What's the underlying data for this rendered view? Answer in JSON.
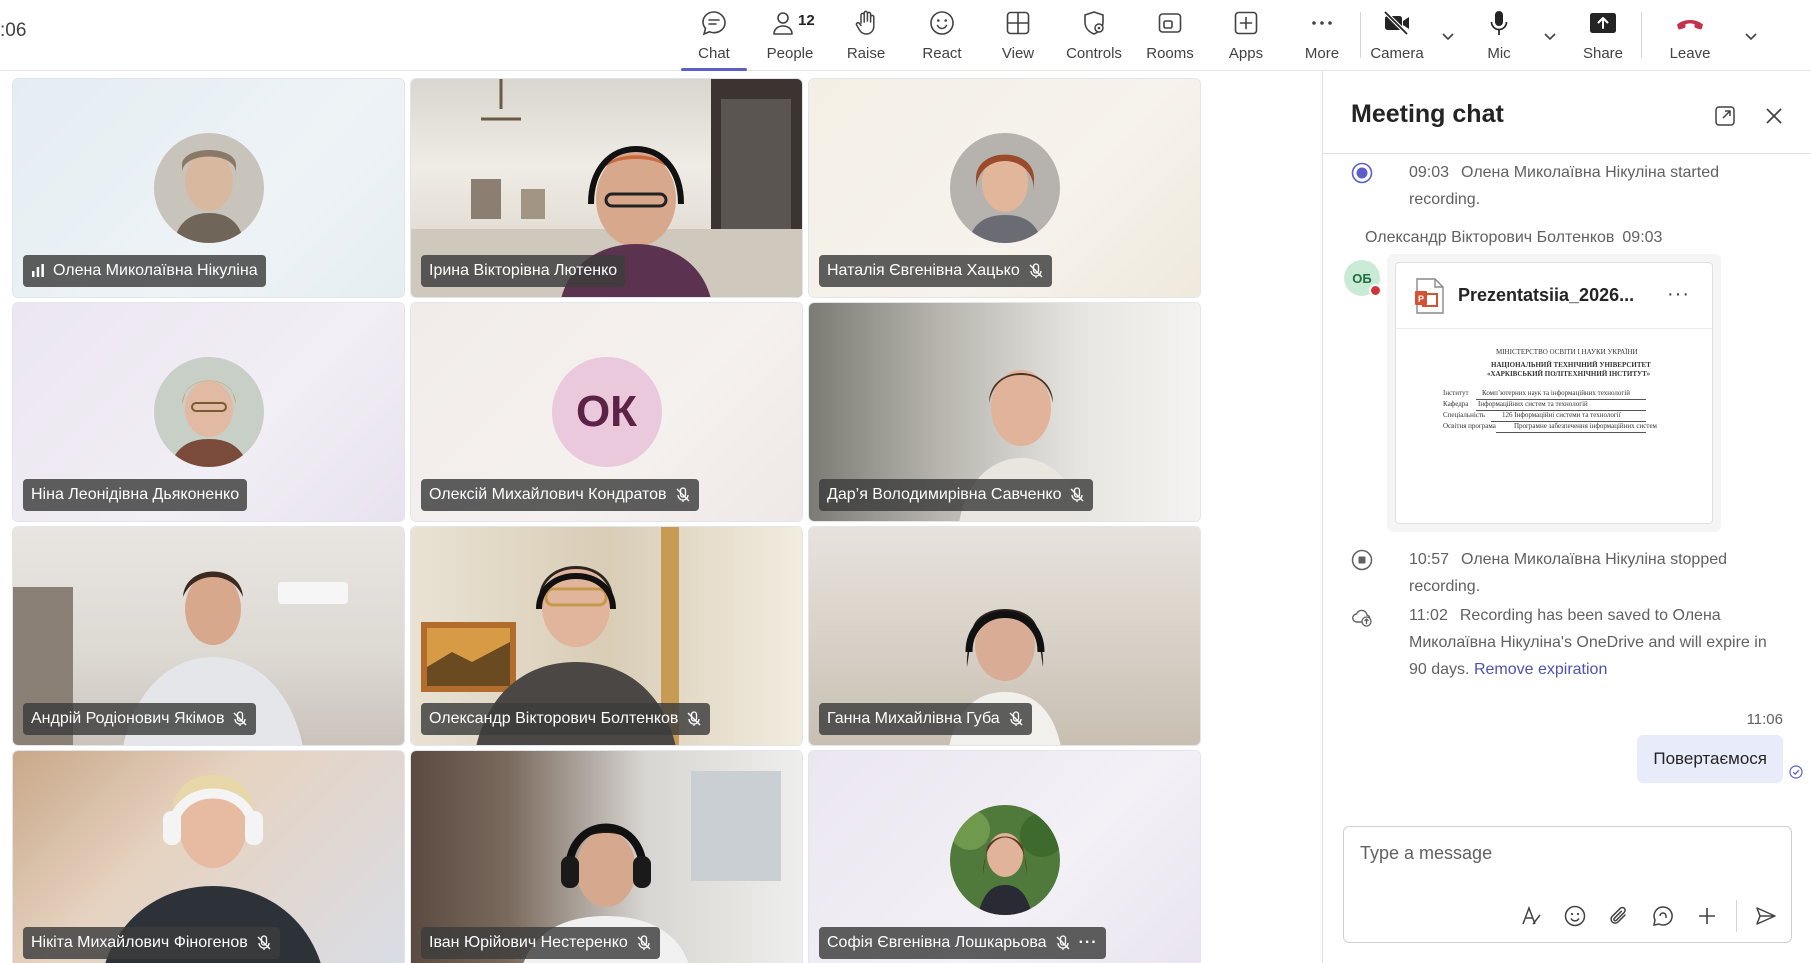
{
  "meeting": {
    "timer": ":06"
  },
  "toolbar": {
    "chat": "Chat",
    "people": "People",
    "people_count": "12",
    "raise": "Raise",
    "react": "React",
    "view": "View",
    "controls": "Controls",
    "rooms": "Rooms",
    "apps": "Apps",
    "more": "More",
    "camera": "Camera",
    "mic": "Mic",
    "share": "Share",
    "leave": "Leave"
  },
  "participants": [
    {
      "name": "Олена Миколаївна Нікуліна",
      "status": "speaking",
      "view": "avatar"
    },
    {
      "name": "Ірина Вікторівна Лютенко",
      "status": "none",
      "view": "video"
    },
    {
      "name": "Наталія Євгенівна Хацько",
      "status": "muted",
      "view": "avatar"
    },
    {
      "name": "Ніна Леонідівна Дьяконенко",
      "status": "none",
      "view": "avatar"
    },
    {
      "name": "Олексій Михайлович Кондратов",
      "status": "muted",
      "view": "initials",
      "initials": "ОК"
    },
    {
      "name": "Дар’я Володимирівна Савченко",
      "status": "muted",
      "view": "video"
    },
    {
      "name": "Андрій Родіонович Якімов",
      "status": "muted",
      "view": "video"
    },
    {
      "name": "Олександр Вікторович Болтенков",
      "status": "muted",
      "view": "video"
    },
    {
      "name": "Ганна Михайлівна Губа",
      "status": "muted",
      "view": "video"
    },
    {
      "name": "Нікіта Михайлович Фіногенов",
      "status": "muted",
      "view": "video"
    },
    {
      "name": "Іван Юрійович Нестеренко",
      "status": "muted",
      "view": "video"
    },
    {
      "name": "Софія Євгенівна Лошкарьова",
      "status": "muted",
      "view": "avatar",
      "more": "···"
    }
  ],
  "chat": {
    "title": "Meeting chat",
    "messages": {
      "rec_start_time": "09:03",
      "rec_start_text": "Олена Миколаївна Нікуліна started recording.",
      "sender": "Олександр Вікторович Болтенков",
      "sender_time": "09:03",
      "sender_initials": "ОБ",
      "file_name": "Prezentatsiia_2026...",
      "file_more": "···",
      "rec_stop_time": "10:57",
      "rec_stop_text": "Олена Миколаївна Нікуліна stopped recording.",
      "saved_time": "11:02",
      "saved_text": "Recording has been saved to Олена Миколаївна Нікуліна's OneDrive and will expire in 90 days.",
      "remove_link": "Remove expiration",
      "my_time": "11:06",
      "my_text": "Повертаємося"
    },
    "doc_preview": {
      "l1": "МІНІСТЕРСТВО ОСВІТИ І НАУКИ УКРАЇНИ",
      "l2": "НАЦІОНАЛЬНИЙ ТЕХНІЧНИЙ УНІВЕРСИТЕТ",
      "l3": "«ХАРКІВСЬКИЙ ПОЛІТЕХНІЧНИЙ ІНСТИТУТ»",
      "r1_label": "Інститут",
      "r1_value": "Комп’ютерних наук та інформаційних технологій",
      "r2_label": "Кафедра",
      "r2_value": "Інформаційних систем та технологій",
      "r3_label": "Спеціальність",
      "r3_value": "126 Інформаційні системи та технології",
      "r4_label": "Освітня програма",
      "r4_value": "Програмне забезпечення інформаційних систем"
    },
    "compose_placeholder": "Type a message"
  },
  "colors": {
    "accent": "#5b5fc7",
    "leave": "#c4314b",
    "link": "#4f52b2",
    "my_bubble": "#e8ebfa"
  }
}
